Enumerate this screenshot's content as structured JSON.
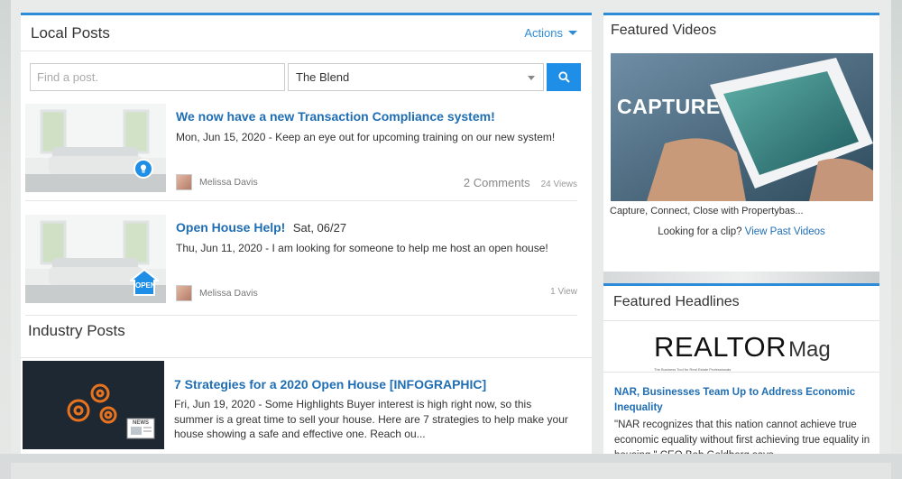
{
  "local_posts": {
    "title": "Local Posts",
    "actions_label": "Actions",
    "search_placeholder": "Find a post.",
    "filter_selected": "The Blend",
    "posts": [
      {
        "title": "We now have a new Transaction Compliance system!",
        "date_inline": "",
        "excerpt": "Mon, Jun 15, 2020 - Keep an eye out for upcoming training on our new system!",
        "author": "Melissa Davis",
        "comments": "2 Comments",
        "views": "24 Views",
        "badge_icon": "bulb-icon"
      },
      {
        "title": "Open House Help!",
        "date_inline": "Sat, 06/27",
        "excerpt": "Thu, Jun 11, 2020 - I am looking for someone to help me host an open house!",
        "author": "Melissa Davis",
        "comments": "",
        "views": "1 View",
        "badge_icon": "open-house-icon",
        "badge_text": "OPEN"
      }
    ]
  },
  "industry_posts": {
    "title": "Industry Posts",
    "post": {
      "title": "7 Strategies for a 2020 Open House [INFOGRAPHIC]",
      "excerpt": "Fri, Jun 19, 2020 - Some Highlights Buyer interest is high right now, so this summer is a great time to sell your house. Here are 7 strategies to help make your house showing a safe and effective one. Reach ou...",
      "thumb_badge": "NEWS"
    }
  },
  "featured_videos": {
    "title": "Featured Videos",
    "video_overlay": "CAPTURE",
    "caption": "Capture, Connect, Close with Propertybas...",
    "clip_prompt": "Looking for a clip?",
    "clip_link": "View Past Videos"
  },
  "featured_headlines": {
    "title": "Featured Headlines",
    "logo_main": "REALTOR",
    "logo_sub": "Mag",
    "logo_tagline": "The Business Tool for Real Estate Professionals",
    "headline": "NAR, Businesses Team Up to Address Economic Inequality",
    "excerpt": "\"NAR recognizes that this nation cannot achieve true economic equality without first achieving true equality in housing,\" CEO Bob Goldberg says."
  },
  "colors": {
    "accent": "#2e8bd8",
    "link": "#1f6eb4",
    "search_button": "#1e8ee6"
  }
}
